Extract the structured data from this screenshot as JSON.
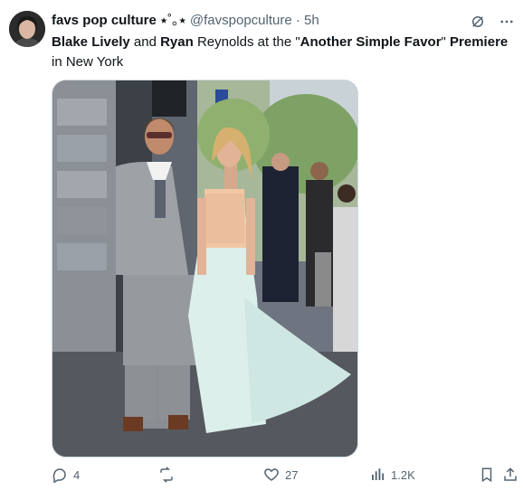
{
  "author": {
    "display_name": "favs pop culture",
    "name_decoration": "⭑˚｡⭑",
    "handle": "@favspopculture",
    "separator": "·",
    "time": "5h"
  },
  "tweet": {
    "segments": [
      {
        "text": "Blake Lively",
        "bold": true
      },
      {
        "text": " and ",
        "bold": false
      },
      {
        "text": "Ryan",
        "bold": true
      },
      {
        "text": " Reynolds at the \"",
        "bold": false
      },
      {
        "text": "Another Simple Favor",
        "bold": true
      },
      {
        "text": "\" ",
        "bold": false
      },
      {
        "text": "Premiere",
        "bold": true
      },
      {
        "text": " in New York",
        "bold": false
      }
    ]
  },
  "actions": {
    "replies": "4",
    "retweets": "",
    "likes": "27",
    "views": "1.2K"
  },
  "colors": {
    "muted": "#536471",
    "text": "#0f1419",
    "border": "#cfd9de"
  }
}
